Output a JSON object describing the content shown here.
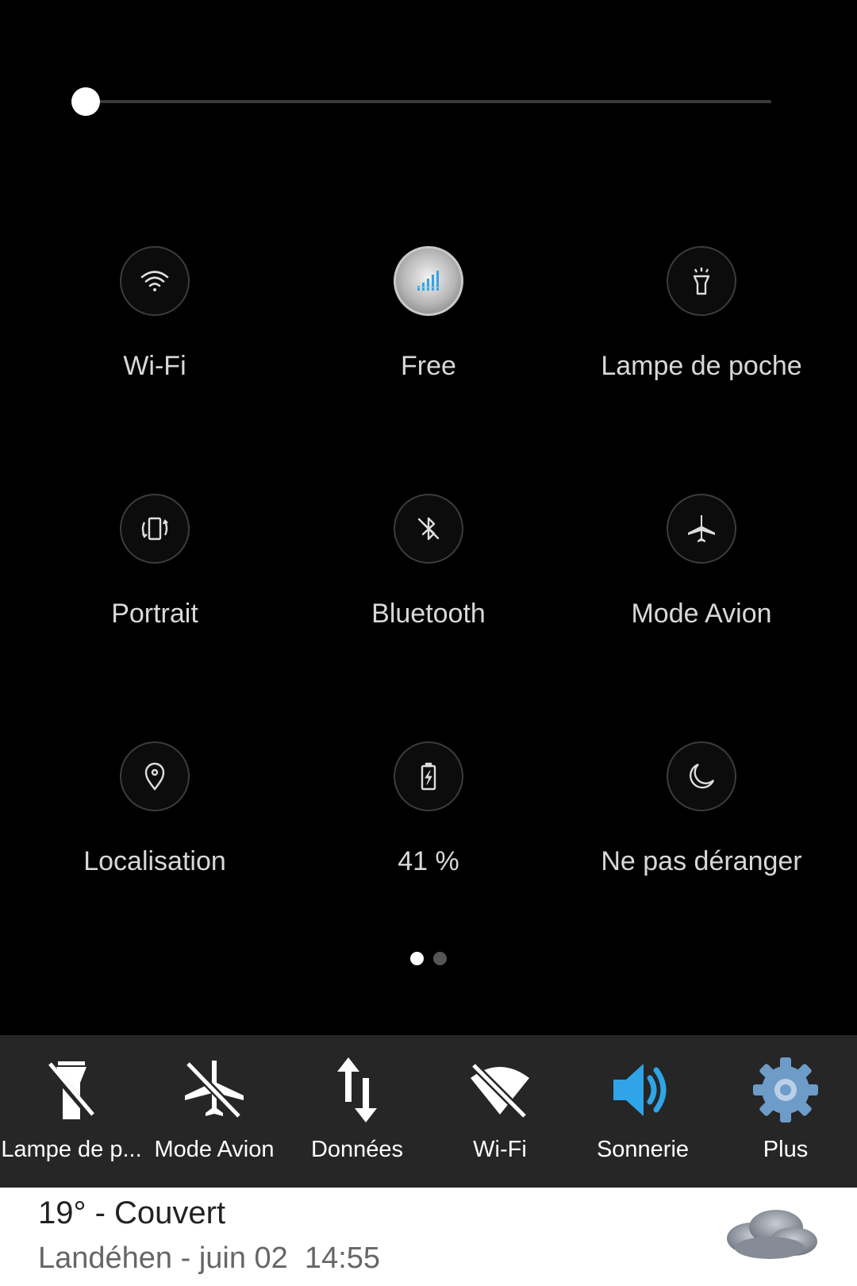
{
  "brightness": {
    "level": 0.0
  },
  "tiles": [
    {
      "label": "Wi-Fi",
      "icon": "wifi-icon"
    },
    {
      "label": "Free",
      "icon": "signal-bars-icon"
    },
    {
      "label": "Lampe de poche",
      "icon": "flashlight-icon"
    },
    {
      "label": "Portrait",
      "icon": "rotate-portrait-icon"
    },
    {
      "label": "Bluetooth",
      "icon": "bluetooth-off-icon"
    },
    {
      "label": "Mode Avion",
      "icon": "airplane-icon"
    },
    {
      "label": "Localisation",
      "icon": "location-pin-icon"
    },
    {
      "label": "41 %",
      "icon": "battery-charging-icon"
    },
    {
      "label": "Ne pas déranger",
      "icon": "moon-icon"
    }
  ],
  "pager": {
    "pages": 2,
    "active": 1
  },
  "toolbar": {
    "items": [
      {
        "label": "Lampe de p...",
        "icon": "flashlight-off-icon"
      },
      {
        "label": "Mode Avion",
        "icon": "airplane-off-icon"
      },
      {
        "label": "Données",
        "icon": "data-arrows-icon"
      },
      {
        "label": "Wi-Fi",
        "icon": "wifi-off-icon"
      },
      {
        "label": "Sonnerie",
        "icon": "speaker-icon"
      },
      {
        "label": "Plus",
        "icon": "gear-icon"
      }
    ]
  },
  "weather": {
    "summary": "19° -  Couvert",
    "location_time": "Landéhen - juin 02  14:55",
    "icon": "cloud-icon"
  },
  "colors": {
    "accent_blue": "#2fa4e7",
    "gear_blue": "#6d9cc9",
    "tile_label": "#d8d8d8"
  }
}
